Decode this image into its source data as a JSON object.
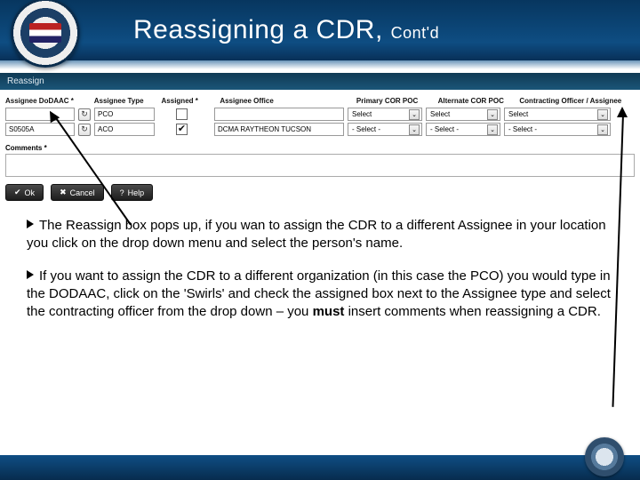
{
  "header": {
    "title_main": "Reassigning a CDR,",
    "title_sub": "Cont'd"
  },
  "panel": {
    "title": "Reassign"
  },
  "columns": {
    "dodaac": "Assignee DoDAAC *",
    "type": "Assignee Type",
    "assigned": "Assigned *",
    "office": "Assignee Office",
    "primary": "Primary COR POC",
    "alternate": "Alternate COR POC",
    "officer": "Contracting Officer / Assignee"
  },
  "row1": {
    "dodaac": "",
    "type": "PCO",
    "assigned_checked": false,
    "office": "",
    "primary": "Select",
    "alternate": "Select",
    "officer": "Select"
  },
  "row2": {
    "dodaac": "S0505A",
    "type": "ACO",
    "assigned_checked": true,
    "office": "DCMA RAYTHEON TUCSON",
    "primary": "- Select -",
    "alternate": "- Select -",
    "officer": "- Select -"
  },
  "comments": {
    "label": "Comments *"
  },
  "buttons": {
    "ok": "Ok",
    "cancel": "Cancel",
    "help": "Help"
  },
  "bullet1": "The Reassign box pops up, if you wan to assign the CDR to a different Assignee in your location you click on the drop down menu and select the person's name.",
  "bullet2_a": "If you want to assign the CDR to a different organization (in this case the PCO) you would type in the DODAAC, click on the 'Swirls' and check the assigned box next to the Assignee type and select the contracting officer from the drop down – you ",
  "bullet2_bold": "must",
  "bullet2_b": " insert comments when reassigning a CDR."
}
